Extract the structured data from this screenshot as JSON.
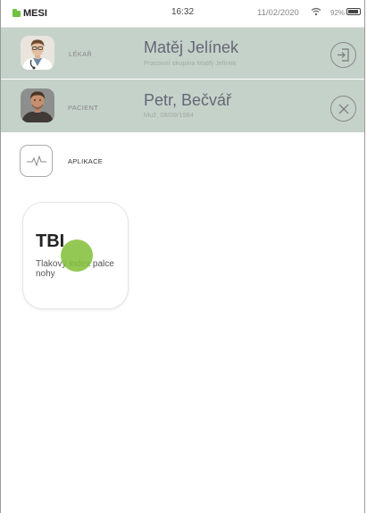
{
  "status_bar": {
    "brand": "MESI",
    "time": "16:32",
    "date": "11/02/2020",
    "battery_percent": "92%",
    "battery_level": 0.92,
    "icons": [
      "folder-icon",
      "wifi-icon",
      "battery-icon"
    ]
  },
  "doctor": {
    "role": "LÉKAŘ",
    "name": "Matěj Jelínek",
    "subtitle": "Pracovní skupina Matěj Jelínek",
    "action_icon": "logout-icon"
  },
  "patient": {
    "role": "PACIENT",
    "name": "Petr, Bečvář",
    "subtitle": "Muž, 08/09/1984",
    "action_icon": "close-icon"
  },
  "apps_section": {
    "label": "APLIKACE",
    "icon": "pulse-icon"
  },
  "apps": [
    {
      "title": "TBI",
      "description": "Tlakový index palce nohy"
    }
  ],
  "colors": {
    "header_bg": "#c5d2c9",
    "brand_green": "#6fc23f",
    "touch_indicator": "#85c03c"
  }
}
